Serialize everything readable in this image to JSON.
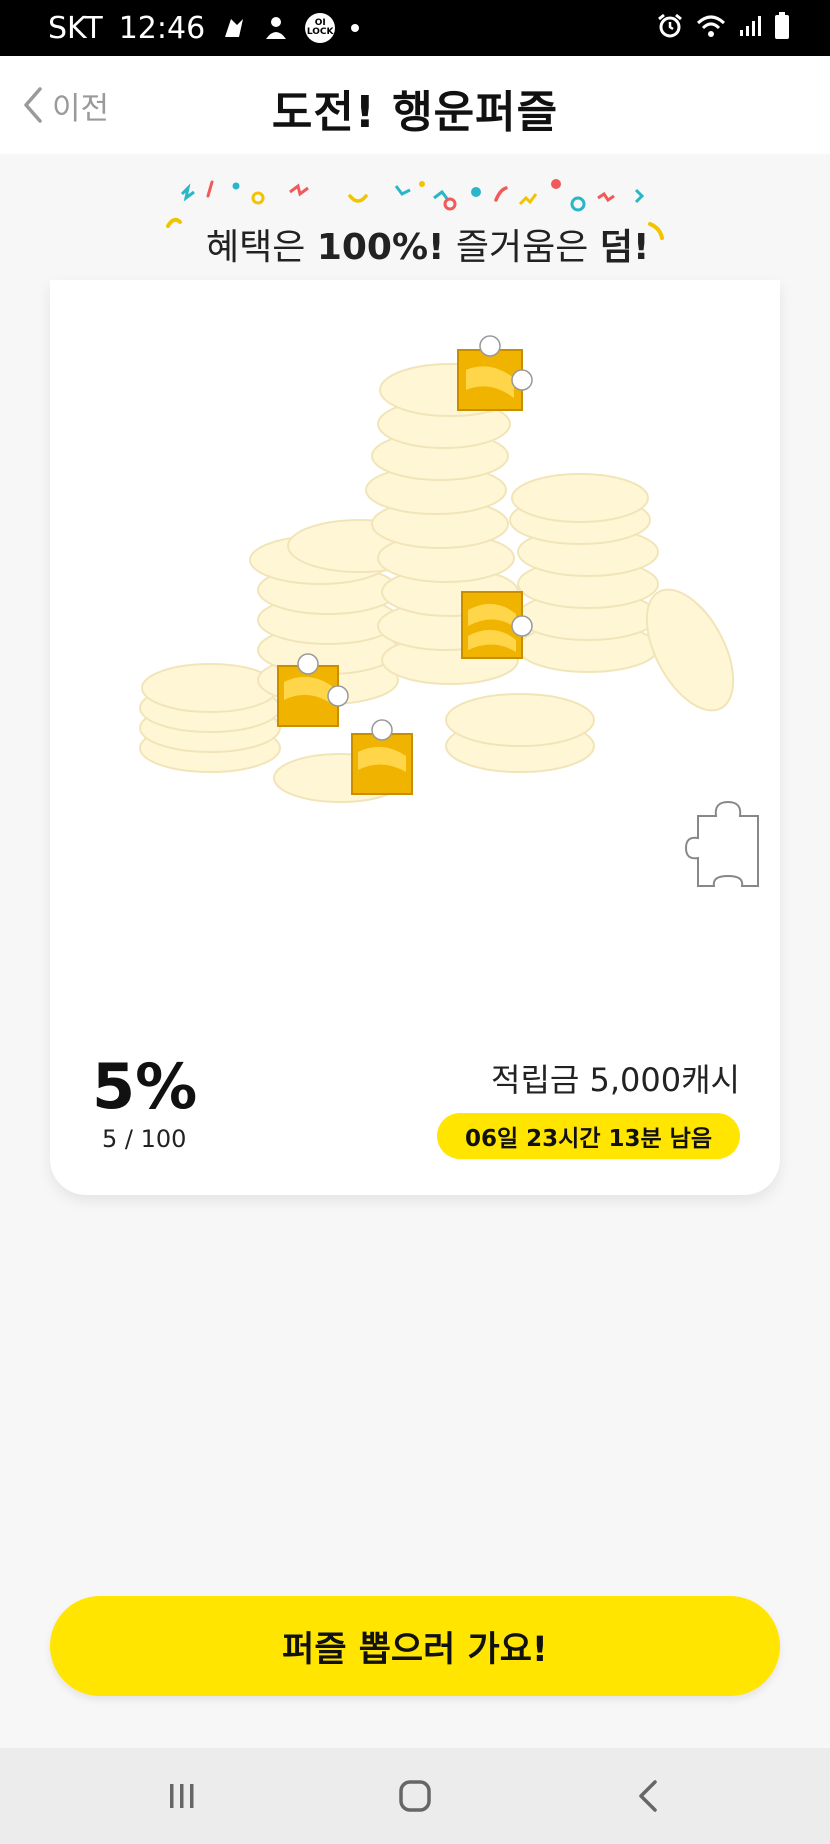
{
  "status_bar": {
    "carrier": "SKT",
    "time": "12:46",
    "badge_text": "OI LOCK"
  },
  "header": {
    "back_label": "이전",
    "title": "도전! 행운퍼즐"
  },
  "banner": {
    "part1": "혜택은 ",
    "bold1": "100%!",
    "part2": " 즐거움은 ",
    "bold2": "덤!"
  },
  "puzzle": {
    "progress_percent": "5%",
    "progress_count": "5 / 100",
    "progress_value": 0.05,
    "reward": "적립금 5,000캐시",
    "time_left": "06일 23시간 13분 남음"
  },
  "cta": {
    "label": "퍼즐 뽑으러 가요!"
  },
  "colors": {
    "accent": "#ffe500",
    "coin_light": "#fff6d6",
    "coin_gold": "#f0b400"
  },
  "icons": {
    "back": "chevron-left-icon",
    "nav_recents": "recents-icon",
    "nav_home": "home-icon",
    "nav_back": "back-icon"
  }
}
